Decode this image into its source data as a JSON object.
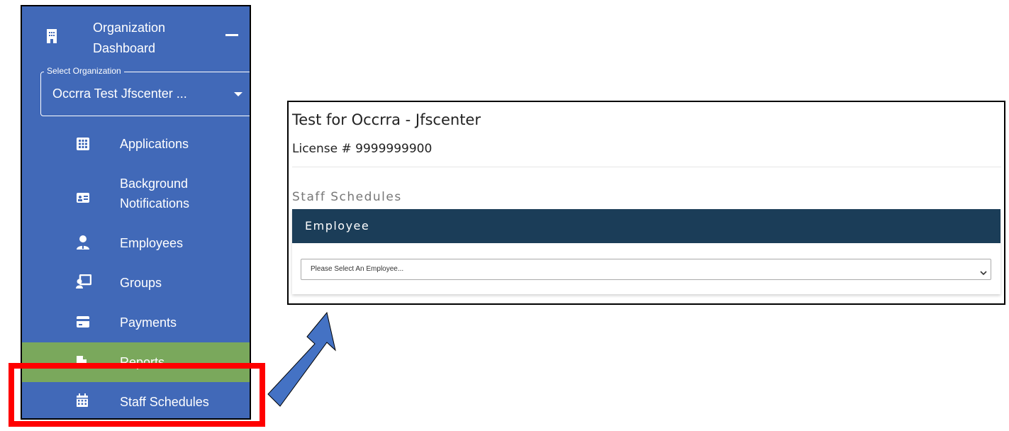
{
  "sidebar": {
    "org_header": {
      "title": "Organization Dashboard"
    },
    "org_select": {
      "legend": "Select Organization",
      "value": "Occrra Test Jfscenter ..."
    },
    "items": [
      {
        "label": "Applications",
        "icon": "grid-icon"
      },
      {
        "label": "Background Notifications",
        "icon": "id-card-icon"
      },
      {
        "label": "Employees",
        "icon": "employee-icon"
      },
      {
        "label": "Groups",
        "icon": "presentation-icon"
      },
      {
        "label": "Payments",
        "icon": "credit-card-icon"
      },
      {
        "label": "Reports",
        "icon": "document-icon"
      },
      {
        "label": "Staff Schedules",
        "icon": "calendar-icon"
      }
    ]
  },
  "panel": {
    "title": "Test for Occrra - Jfscenter",
    "license": "License # 9999999900",
    "section_title": "Staff Schedules",
    "card_header": "Employee",
    "employee_select": {
      "placeholder": "Please Select An Employee..."
    }
  },
  "colors": {
    "sidebar_bg": "#4169b8",
    "active_item_bg": "#7aa85c",
    "card_header_bg": "#1b3d58",
    "highlight": "#ff0000",
    "arrow": "#4472c4"
  }
}
